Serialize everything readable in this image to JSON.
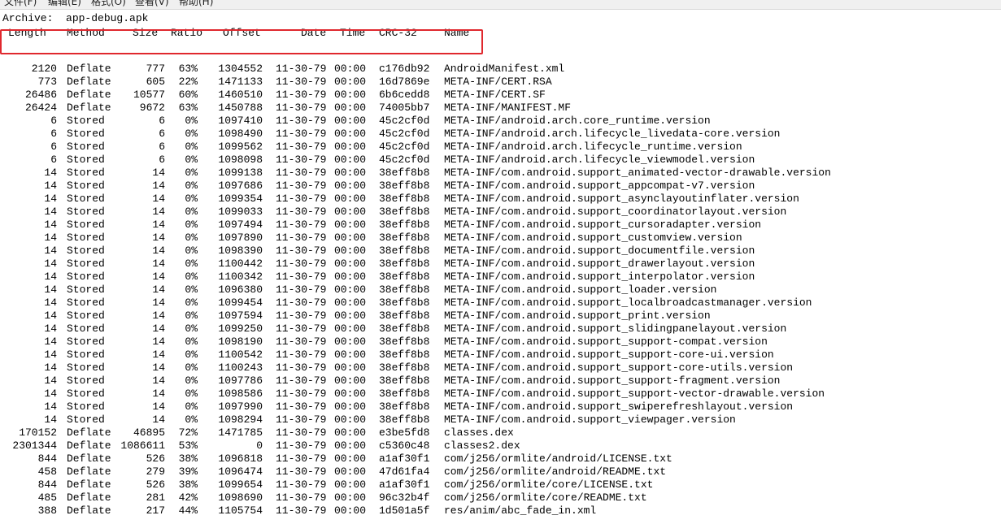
{
  "menu": [
    "文件(F)",
    "编辑(E)",
    "格式(O)",
    "查看(V)",
    "帮助(H)"
  ],
  "archive_line": "Archive:  app-debug.apk",
  "headers": [
    "Length",
    "Method",
    "Size",
    "Ratio",
    "Offset",
    "Date",
    "Time",
    "CRC-32",
    "Name"
  ],
  "rows": [
    [
      "2120",
      "Deflate",
      "777",
      "63%",
      "1304552",
      "11-30-79",
      "00:00",
      "c176db92",
      "AndroidManifest.xml"
    ],
    [
      "773",
      "Deflate",
      "605",
      "22%",
      "1471133",
      "11-30-79",
      "00:00",
      "16d7869e",
      "META-INF/CERT.RSA"
    ],
    [
      "26486",
      "Deflate",
      "10577",
      "60%",
      "1460510",
      "11-30-79",
      "00:00",
      "6b6cedd8",
      "META-INF/CERT.SF"
    ],
    [
      "26424",
      "Deflate",
      "9672",
      "63%",
      "1450788",
      "11-30-79",
      "00:00",
      "74005bb7",
      "META-INF/MANIFEST.MF"
    ],
    [
      "6",
      "Stored",
      "6",
      "0%",
      "1097410",
      "11-30-79",
      "00:00",
      "45c2cf0d",
      "META-INF/android.arch.core_runtime.version"
    ],
    [
      "6",
      "Stored",
      "6",
      "0%",
      "1098490",
      "11-30-79",
      "00:00",
      "45c2cf0d",
      "META-INF/android.arch.lifecycle_livedata-core.version"
    ],
    [
      "6",
      "Stored",
      "6",
      "0%",
      "1099562",
      "11-30-79",
      "00:00",
      "45c2cf0d",
      "META-INF/android.arch.lifecycle_runtime.version"
    ],
    [
      "6",
      "Stored",
      "6",
      "0%",
      "1098098",
      "11-30-79",
      "00:00",
      "45c2cf0d",
      "META-INF/android.arch.lifecycle_viewmodel.version"
    ],
    [
      "14",
      "Stored",
      "14",
      "0%",
      "1099138",
      "11-30-79",
      "00:00",
      "38eff8b8",
      "META-INF/com.android.support_animated-vector-drawable.version"
    ],
    [
      "14",
      "Stored",
      "14",
      "0%",
      "1097686",
      "11-30-79",
      "00:00",
      "38eff8b8",
      "META-INF/com.android.support_appcompat-v7.version"
    ],
    [
      "14",
      "Stored",
      "14",
      "0%",
      "1099354",
      "11-30-79",
      "00:00",
      "38eff8b8",
      "META-INF/com.android.support_asynclayoutinflater.version"
    ],
    [
      "14",
      "Stored",
      "14",
      "0%",
      "1099033",
      "11-30-79",
      "00:00",
      "38eff8b8",
      "META-INF/com.android.support_coordinatorlayout.version"
    ],
    [
      "14",
      "Stored",
      "14",
      "0%",
      "1097494",
      "11-30-79",
      "00:00",
      "38eff8b8",
      "META-INF/com.android.support_cursoradapter.version"
    ],
    [
      "14",
      "Stored",
      "14",
      "0%",
      "1097890",
      "11-30-79",
      "00:00",
      "38eff8b8",
      "META-INF/com.android.support_customview.version"
    ],
    [
      "14",
      "Stored",
      "14",
      "0%",
      "1098390",
      "11-30-79",
      "00:00",
      "38eff8b8",
      "META-INF/com.android.support_documentfile.version"
    ],
    [
      "14",
      "Stored",
      "14",
      "0%",
      "1100442",
      "11-30-79",
      "00:00",
      "38eff8b8",
      "META-INF/com.android.support_drawerlayout.version"
    ],
    [
      "14",
      "Stored",
      "14",
      "0%",
      "1100342",
      "11-30-79",
      "00:00",
      "38eff8b8",
      "META-INF/com.android.support_interpolator.version"
    ],
    [
      "14",
      "Stored",
      "14",
      "0%",
      "1096380",
      "11-30-79",
      "00:00",
      "38eff8b8",
      "META-INF/com.android.support_loader.version"
    ],
    [
      "14",
      "Stored",
      "14",
      "0%",
      "1099454",
      "11-30-79",
      "00:00",
      "38eff8b8",
      "META-INF/com.android.support_localbroadcastmanager.version"
    ],
    [
      "14",
      "Stored",
      "14",
      "0%",
      "1097594",
      "11-30-79",
      "00:00",
      "38eff8b8",
      "META-INF/com.android.support_print.version"
    ],
    [
      "14",
      "Stored",
      "14",
      "0%",
      "1099250",
      "11-30-79",
      "00:00",
      "38eff8b8",
      "META-INF/com.android.support_slidingpanelayout.version"
    ],
    [
      "14",
      "Stored",
      "14",
      "0%",
      "1098190",
      "11-30-79",
      "00:00",
      "38eff8b8",
      "META-INF/com.android.support_support-compat.version"
    ],
    [
      "14",
      "Stored",
      "14",
      "0%",
      "1100542",
      "11-30-79",
      "00:00",
      "38eff8b8",
      "META-INF/com.android.support_support-core-ui.version"
    ],
    [
      "14",
      "Stored",
      "14",
      "0%",
      "1100243",
      "11-30-79",
      "00:00",
      "38eff8b8",
      "META-INF/com.android.support_support-core-utils.version"
    ],
    [
      "14",
      "Stored",
      "14",
      "0%",
      "1097786",
      "11-30-79",
      "00:00",
      "38eff8b8",
      "META-INF/com.android.support_support-fragment.version"
    ],
    [
      "14",
      "Stored",
      "14",
      "0%",
      "1098586",
      "11-30-79",
      "00:00",
      "38eff8b8",
      "META-INF/com.android.support_support-vector-drawable.version"
    ],
    [
      "14",
      "Stored",
      "14",
      "0%",
      "1097990",
      "11-30-79",
      "00:00",
      "38eff8b8",
      "META-INF/com.android.support_swiperefreshlayout.version"
    ],
    [
      "14",
      "Stored",
      "14",
      "0%",
      "1098294",
      "11-30-79",
      "00:00",
      "38eff8b8",
      "META-INF/com.android.support_viewpager.version"
    ],
    [
      "170152",
      "Deflate",
      "46895",
      "72%",
      "1471785",
      "11-30-79",
      "00:00",
      "e3be5fd8",
      "classes.dex"
    ],
    [
      "2301344",
      "Deflate",
      "1086611",
      "53%",
      "0",
      "11-30-79",
      "00:00",
      "c5360c48",
      "classes2.dex"
    ],
    [
      "844",
      "Deflate",
      "526",
      "38%",
      "1096818",
      "11-30-79",
      "00:00",
      "a1af30f1",
      "com/j256/ormlite/android/LICENSE.txt"
    ],
    [
      "458",
      "Deflate",
      "279",
      "39%",
      "1096474",
      "11-30-79",
      "00:00",
      "47d61fa4",
      "com/j256/ormlite/android/README.txt"
    ],
    [
      "844",
      "Deflate",
      "526",
      "38%",
      "1099654",
      "11-30-79",
      "00:00",
      "a1af30f1",
      "com/j256/ormlite/core/LICENSE.txt"
    ],
    [
      "485",
      "Deflate",
      "281",
      "42%",
      "1098690",
      "11-30-79",
      "00:00",
      "96c32b4f",
      "com/j256/ormlite/core/README.txt"
    ],
    [
      "388",
      "Deflate",
      "217",
      "44%",
      "1105754",
      "11-30-79",
      "00:00",
      "1d501a5f",
      "res/anim/abc_fade_in.xml"
    ]
  ],
  "colors": {
    "highlight_border": "#e0282e",
    "text": "#000000",
    "background": "#ffffff"
  }
}
